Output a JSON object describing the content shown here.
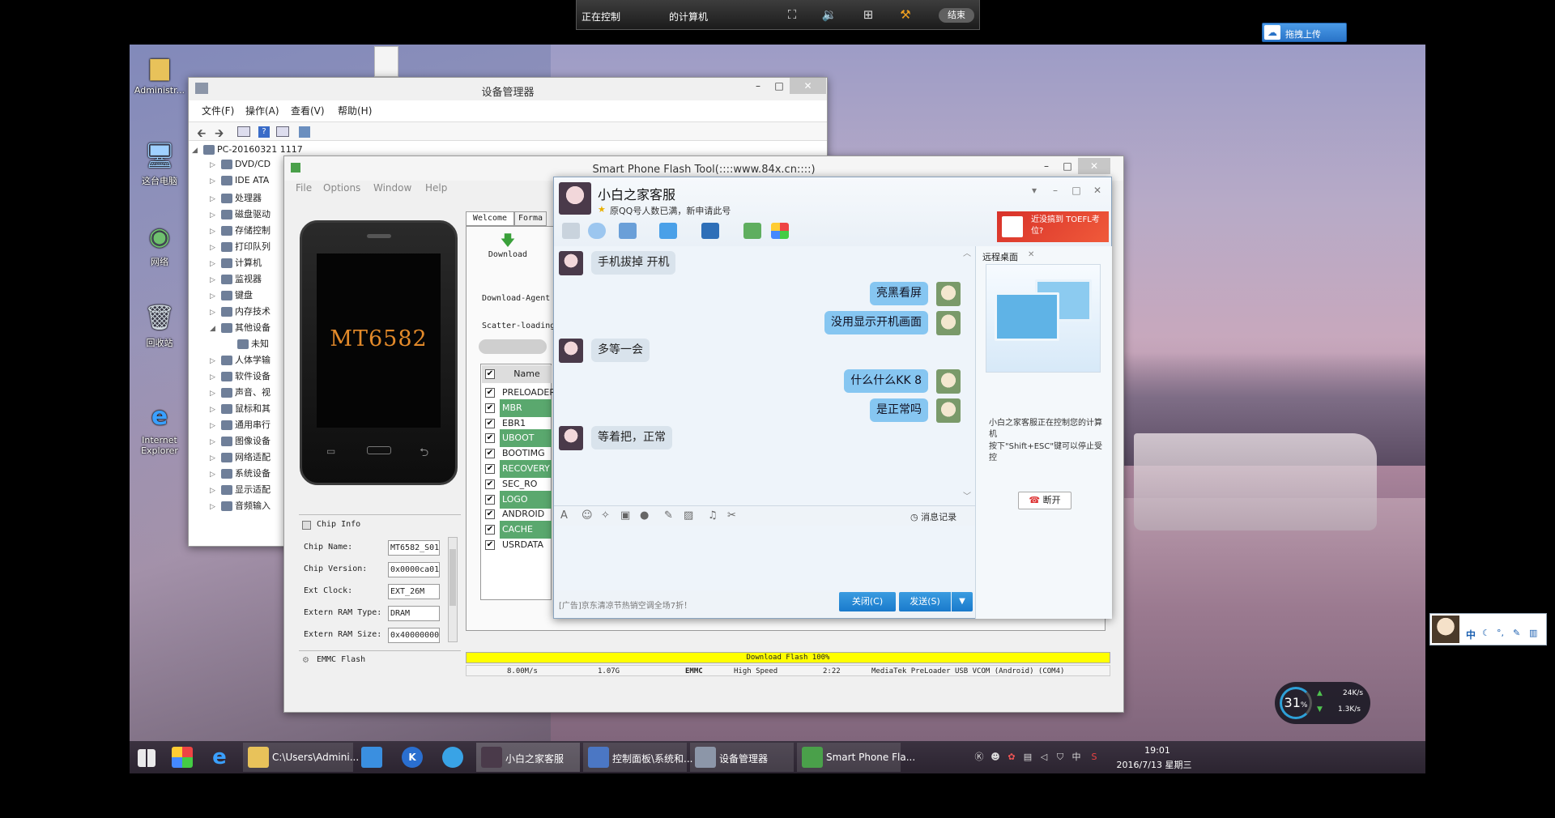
{
  "remote_bar": {
    "status_prefix": "正在控制",
    "status_suffix": "的计算机",
    "end_label": "结束",
    "icons": [
      "fullscreen-icon",
      "volume-icon",
      "window-layout-icon",
      "pin-icon"
    ]
  },
  "upload_button": {
    "label": "拖拽上传"
  },
  "desktop_icons": [
    {
      "label": "Administr...",
      "icon": "folder-icon"
    },
    {
      "label": "这台电脑",
      "icon": "computer-icon"
    },
    {
      "label": "网络",
      "icon": "network-icon"
    },
    {
      "label": "回收站",
      "icon": "recycle-bin-icon"
    },
    {
      "label": "Internet Explorer",
      "icon": "ie-icon"
    }
  ],
  "device_manager": {
    "title": "设备管理器",
    "menu": [
      "文件(F)",
      "操作(A)",
      "查看(V)",
      "帮助(H)"
    ],
    "root": "PC-20160321 1117",
    "tree": [
      "DVD/CD",
      "IDE ATA",
      "处理器",
      "磁盘驱动",
      "存储控制",
      "打印队列",
      "计算机",
      "监视器",
      "键盘",
      "内存技术",
      "其他设备",
      "未知",
      "人体学输",
      "软件设备",
      "声音、视",
      "鼠标和其",
      "通用串行",
      "图像设备",
      "网络适配",
      "系统设备",
      "显示适配",
      "音频输入"
    ]
  },
  "flash_tool": {
    "title": "Smart Phone Flash Tool(::::www.84x.cn::::)",
    "menu": [
      "File",
      "Options",
      "Window",
      "Help"
    ],
    "tabs": [
      "Welcome",
      "Forma"
    ],
    "download_label": "Download",
    "download_agent_label": "Download-Agent",
    "scatter_label": "Scatter-loading",
    "phone_model": "MT6582",
    "name_header": "Name",
    "partitions": [
      {
        "name": "PRELOADER",
        "highlight": false
      },
      {
        "name": "MBR",
        "highlight": true
      },
      {
        "name": "EBR1",
        "highlight": false
      },
      {
        "name": "UBOOT",
        "highlight": true
      },
      {
        "name": "BOOTIMG",
        "highlight": false
      },
      {
        "name": "RECOVERY",
        "highlight": true
      },
      {
        "name": "SEC_RO",
        "highlight": false
      },
      {
        "name": "LOGO",
        "highlight": true
      },
      {
        "name": "ANDROID",
        "highlight": false
      },
      {
        "name": "CACHE",
        "highlight": true
      },
      {
        "name": "USRDATA",
        "highlight": false
      }
    ],
    "chip_info_title": "Chip Info",
    "chip_fields": [
      {
        "label": "Chip Name:",
        "value": "MT6582_S01"
      },
      {
        "label": "Chip Version:",
        "value": "0x0000ca01"
      },
      {
        "label": "Ext Clock:",
        "value": "EXT_26M"
      },
      {
        "label": "Extern RAM Type:",
        "value": "DRAM"
      },
      {
        "label": "Extern RAM Size:",
        "value": "0x40000000"
      }
    ],
    "emmc_label": "EMMC Flash",
    "progress": {
      "label": "Download Flash 100%",
      "percent": 100,
      "color": "#ffff00"
    },
    "status": {
      "speed": "8.00M/s",
      "size": "1.07G",
      "storage": "EMMC",
      "mode": "High Speed",
      "time": "2:22",
      "port": "MediaTek PreLoader USB VCOM (Android) (COM4)"
    }
  },
  "qq_chat": {
    "contact_name": "小白之家客服",
    "signature": "原QQ号人数已满，新申请此号",
    "ad_banner": "近没搞到 TOEFL考位?",
    "messages": [
      {
        "from": "in",
        "text": "手机拔掉 开机"
      },
      {
        "from": "out",
        "text": "亮黑看屏"
      },
      {
        "from": "out",
        "text": "没用显示开机画面"
      },
      {
        "from": "in",
        "text": "多等一会"
      },
      {
        "from": "out",
        "text": "什么什么KK 8"
      },
      {
        "from": "out",
        "text": "是正常吗"
      },
      {
        "from": "in",
        "text": "等着把，正常"
      }
    ],
    "history_label": "消息记录",
    "ad_text": "[广告]京东清凉节热销空调全场7折！",
    "close_button": "关闭(C)",
    "send_button": "发送(S)",
    "side_tab": "远程桌面",
    "remote_notice": "小白之家客服正在控制您的计算机",
    "remote_hint": "按下\"Shift+ESC\"键可以停止受控",
    "disconnect_label": "断开"
  },
  "taskbar": {
    "items": [
      {
        "label": "",
        "icon": "start-icon"
      },
      {
        "label": "",
        "icon": "app-clover-icon"
      },
      {
        "label": "",
        "icon": "ie-icon"
      },
      {
        "label": "C:\\Users\\Admini...",
        "icon": "folder-icon"
      },
      {
        "label": "",
        "icon": "bird-icon"
      },
      {
        "label": "",
        "icon": "k-icon"
      },
      {
        "label": "",
        "icon": "browser-icon"
      },
      {
        "label": "小白之家客服",
        "icon": "qq-avatar-icon"
      },
      {
        "label": "控制面板\\系统和...",
        "icon": "control-panel-icon"
      },
      {
        "label": "设备管理器",
        "icon": "device-manager-icon"
      },
      {
        "label": "Smart Phone Fla...",
        "icon": "flash-tool-icon"
      }
    ],
    "time": "19:01",
    "date": "2016/7/13 星期三",
    "ime": "中"
  },
  "net_monitor": {
    "percent": "31",
    "percent_unit": "%",
    "up": "24K/s",
    "down": "1.3K/s"
  },
  "ime_bar": {
    "mode": "中"
  }
}
